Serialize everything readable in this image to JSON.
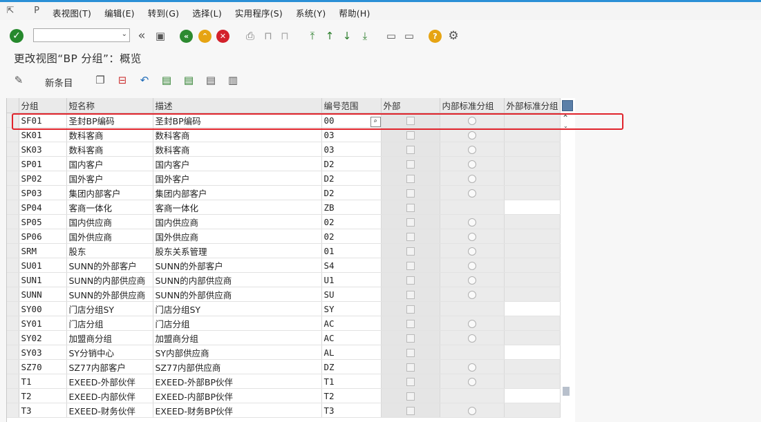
{
  "menu": [
    "表视图(T)",
    "编辑(E)",
    "转到(G)",
    "选择(L)",
    "实用程序(S)",
    "系统(Y)",
    "帮助(H)"
  ],
  "command_field": {
    "value": ""
  },
  "page_title": "更改视图“BP 分组”：概览",
  "app_toolbar": {
    "new_entries": "新条目"
  },
  "table": {
    "headers": [
      "分组",
      "短名称",
      "描述",
      "编号范围",
      "外部",
      "内部标准分组",
      "外部标准分组"
    ],
    "rows": [
      {
        "group": "SF01",
        "short": "圣封BP编码",
        "desc": "圣封BP编码",
        "range": "00",
        "external": false,
        "has_internal_std": true
      },
      {
        "group": "SK01",
        "short": "数科客商",
        "desc": "数科客商",
        "range": "03",
        "external": false,
        "has_internal_std": true
      },
      {
        "group": "SK03",
        "short": "数科客商",
        "desc": "数科客商",
        "range": "03",
        "external": false,
        "has_internal_std": true
      },
      {
        "group": "SP01",
        "short": "国内客户",
        "desc": "国内客户",
        "range": "D2",
        "external": false,
        "has_internal_std": true
      },
      {
        "group": "SP02",
        "short": "国外客户",
        "desc": "国外客户",
        "range": "D2",
        "external": false,
        "has_internal_std": true
      },
      {
        "group": "SP03",
        "short": "集团内部客户",
        "desc": "集团内部客户",
        "range": "D2",
        "external": false,
        "has_internal_std": true
      },
      {
        "group": "SP04",
        "short": "客商一体化",
        "desc": "客商一体化",
        "range": "ZB",
        "external": false,
        "has_internal_std": false
      },
      {
        "group": "SP05",
        "short": "国内供应商",
        "desc": "国内供应商",
        "range": "02",
        "external": false,
        "has_internal_std": true
      },
      {
        "group": "SP06",
        "short": "国外供应商",
        "desc": "国外供应商",
        "range": "02",
        "external": false,
        "has_internal_std": true
      },
      {
        "group": "SRM",
        "short": "股东",
        "desc": "股东关系管理",
        "range": "01",
        "external": false,
        "has_internal_std": true
      },
      {
        "group": "SU01",
        "short": "SUNN的外部客户",
        "desc": "SUNN的外部客户",
        "range": "S4",
        "external": false,
        "has_internal_std": true
      },
      {
        "group": "SUN1",
        "short": "SUNN的内部供应商",
        "desc": "SUNN的内部供应商",
        "range": "U1",
        "external": false,
        "has_internal_std": true
      },
      {
        "group": "SUNN",
        "short": "SUNN的外部供应商",
        "desc": "SUNN的外部供应商",
        "range": "SU",
        "external": false,
        "has_internal_std": true
      },
      {
        "group": "SY00",
        "short": "门店分组SY",
        "desc": "门店分组SY",
        "range": "SY",
        "external": false,
        "has_internal_std": false
      },
      {
        "group": "SY01",
        "short": "门店分组",
        "desc": "门店分组",
        "range": "AC",
        "external": false,
        "has_internal_std": true
      },
      {
        "group": "SY02",
        "short": "加盟商分组",
        "desc": "加盟商分组",
        "range": "AC",
        "external": false,
        "has_internal_std": true
      },
      {
        "group": "SY03",
        "short": "SY分销中心",
        "desc": "SY内部供应商",
        "range": "AL",
        "external": false,
        "has_internal_std": false
      },
      {
        "group": "SZ70",
        "short": "SZ77内部客户",
        "desc": "SZ77内部供应商",
        "range": "DZ",
        "external": false,
        "has_internal_std": true
      },
      {
        "group": "T1",
        "short": "EXEED-外部伙伴",
        "desc": "EXEED-外部BP伙伴",
        "range": "T1",
        "external": false,
        "has_internal_std": true
      },
      {
        "group": "T2",
        "short": "EXEED-内部伙伴",
        "desc": "EXEED-内部BP伙伴",
        "range": "T2",
        "external": false,
        "has_internal_std": false
      },
      {
        "group": "T3",
        "short": "EXEED-财务伙伴",
        "desc": "EXEED-财务BP伙伴",
        "range": "T3",
        "external": false,
        "has_internal_std": true
      }
    ]
  }
}
